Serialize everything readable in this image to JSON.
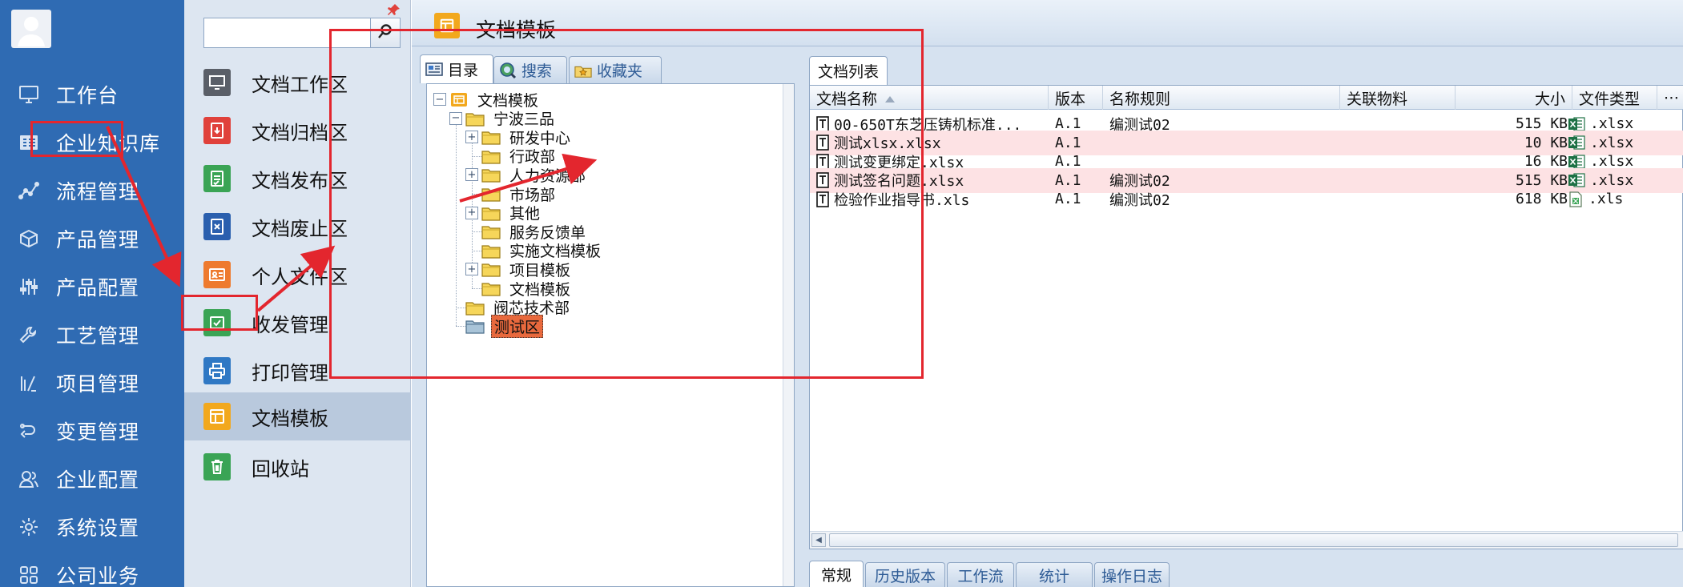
{
  "nav": {
    "items": [
      {
        "label": "工作台",
        "icon": "monitor-icon"
      },
      {
        "label": "企业知识库",
        "icon": "book-icon"
      },
      {
        "label": "流程管理",
        "icon": "flow-icon"
      },
      {
        "label": "产品管理",
        "icon": "box-icon"
      },
      {
        "label": "产品配置",
        "icon": "sliders-icon"
      },
      {
        "label": "工艺管理",
        "icon": "wrench-icon"
      },
      {
        "label": "项目管理",
        "icon": "project-icon"
      },
      {
        "label": "变更管理",
        "icon": "change-icon"
      },
      {
        "label": "企业配置",
        "icon": "users-icon"
      },
      {
        "label": "系统设置",
        "icon": "gear-icon"
      },
      {
        "label": "公司业务",
        "icon": "grid-icon"
      }
    ]
  },
  "sub": {
    "search_value": "",
    "items": [
      {
        "label": "文档工作区",
        "color": "#5a5f68"
      },
      {
        "label": "文档归档区",
        "color": "#e0413b"
      },
      {
        "label": "文档发布区",
        "color": "#3aa455"
      },
      {
        "label": "文档废止区",
        "color": "#2a5fae"
      },
      {
        "label": "个人文件区",
        "color": "#ee7a2e"
      },
      {
        "label": "收发管理",
        "color": "#3aa455"
      },
      {
        "label": "打印管理",
        "color": "#2f78c4"
      },
      {
        "label": "文档模板",
        "color": "#f2a81d"
      },
      {
        "label": "回收站",
        "color": "#3aa455"
      }
    ]
  },
  "main": {
    "title": "文档模板",
    "left_tabs": [
      "目录",
      "搜索",
      "收藏夹"
    ],
    "tree": [
      {
        "label": "文档模板",
        "toggle": "-",
        "level": 0
      },
      {
        "label": "宁波三品",
        "toggle": "-",
        "level": 1
      },
      {
        "label": "研发中心",
        "toggle": "+",
        "level": 2
      },
      {
        "label": "行政部",
        "toggle": "",
        "level": 2
      },
      {
        "label": "人力资源部",
        "toggle": "+",
        "level": 2
      },
      {
        "label": "市场部",
        "toggle": "",
        "level": 2
      },
      {
        "label": "其他",
        "toggle": "+",
        "level": 2
      },
      {
        "label": "服务反馈单",
        "toggle": "",
        "level": 2
      },
      {
        "label": "实施文档模板",
        "toggle": "",
        "level": 2
      },
      {
        "label": "项目模板",
        "toggle": "+",
        "level": 2
      },
      {
        "label": "文档模板",
        "toggle": "",
        "level": 2
      },
      {
        "label": "阀芯技术部",
        "toggle": "",
        "level": 1
      },
      {
        "label": "测试区",
        "toggle": "",
        "level": 1
      }
    ],
    "right_tab": "文档列表",
    "columns": [
      "文档名称",
      "版本",
      "名称规则",
      "关联物料",
      "大小",
      "文件类型"
    ],
    "rows": [
      {
        "name": "00-650T东芝压铸机标准...",
        "ver": "A.1",
        "rule": "编测试02",
        "size": "515 KB",
        "type": ".xlsx"
      },
      {
        "name": "测试xlsx.xlsx",
        "ver": "A.1",
        "rule": "",
        "size": "10 KB",
        "type": ".xlsx"
      },
      {
        "name": "测试变更绑定.xlsx",
        "ver": "A.1",
        "rule": "",
        "size": "16 KB",
        "type": ".xlsx"
      },
      {
        "name": "测试签名问题.xlsx",
        "ver": "A.1",
        "rule": "编测试02",
        "size": "515 KB",
        "type": ".xlsx"
      },
      {
        "name": "检验作业指导书.xls",
        "ver": "A.1",
        "rule": "编测试02",
        "size": "618 KB",
        "type": ".xls"
      }
    ],
    "bottom_tabs": [
      "常规",
      "历史版本",
      "工作流",
      "统计",
      "操作日志"
    ]
  },
  "colors": {
    "nav_bg": "#2f6bb3",
    "annotation": "#e3262e",
    "row_alt": "#fde2e4"
  }
}
